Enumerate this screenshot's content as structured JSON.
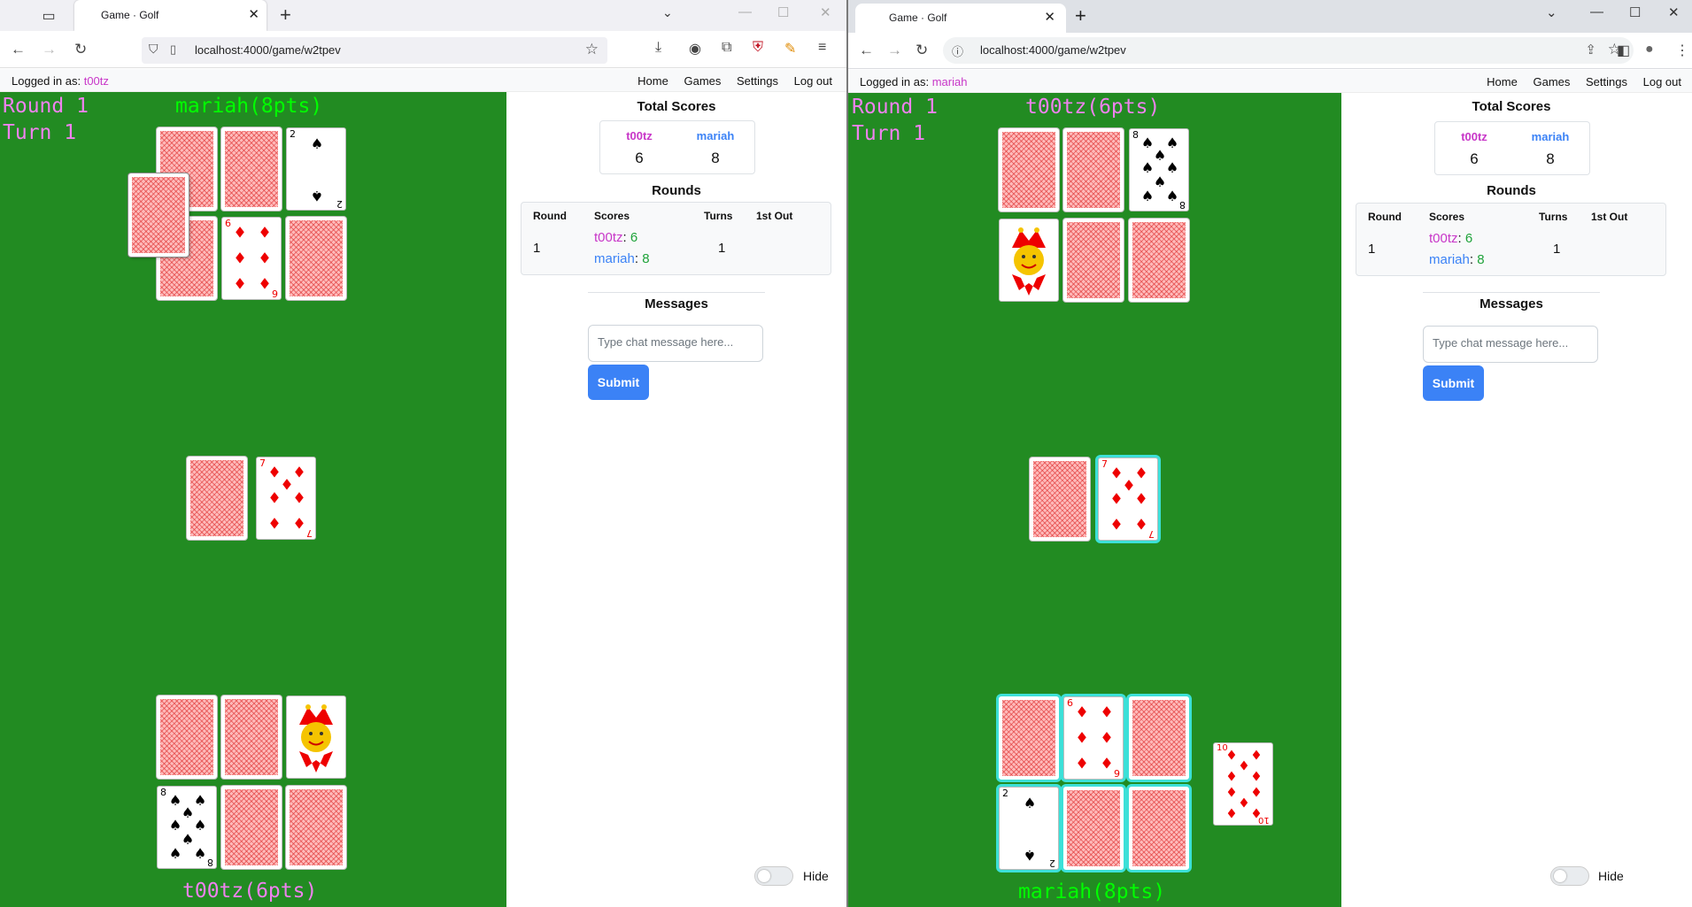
{
  "left_window": {
    "tab_title": "Game · Golf",
    "url": "localhost:4000/game/w2tpev",
    "logged_in_label": "Logged in as:",
    "user": "t00tz",
    "nav": [
      "Home",
      "Games",
      "Settings",
      "Log out"
    ],
    "round_label": "Round 1",
    "turn_label": "Turn 1",
    "opponent": "mariah(8pts)",
    "me": "t00tz(6pts)"
  },
  "right_window": {
    "tab_title": "Game · Golf",
    "url": "localhost:4000/game/w2tpev",
    "logged_in_label": "Logged in as:",
    "user": "mariah",
    "nav": [
      "Home",
      "Games",
      "Settings",
      "Log out"
    ],
    "round_label": "Round 1",
    "turn_label": "Turn 1",
    "opponent": "t00tz(6pts)",
    "me": "mariah(8pts)"
  },
  "cards": {
    "two": "2",
    "six": "6",
    "seven": "7",
    "eight": "8",
    "ten": "10",
    "spade": "♠",
    "diamond": "♦"
  },
  "panel": {
    "total_scores_title": "Total Scores",
    "players": [
      {
        "name": "t00tz",
        "score": "6",
        "color": "#c837c8"
      },
      {
        "name": "mariah",
        "score": "8",
        "color": "#3b82f6"
      }
    ],
    "rounds_title": "Rounds",
    "rounds_headers": [
      "Round",
      "Scores",
      "Turns",
      "1st Out"
    ],
    "rounds_rows": [
      {
        "round": "1",
        "p1_name": "t00tz",
        "p1_score": "6",
        "p2_name": "mariah",
        "p2_score": "8",
        "turns": "1",
        "first_out": ""
      }
    ],
    "messages_title": "Messages",
    "chat_placeholder": "Type chat message here...",
    "submit_label": "Submit",
    "hide_label": "Hide"
  },
  "colors": {
    "table_green": "#228b22",
    "round_turn_text": "#ee82ee",
    "active_name": "#00ff00",
    "inactive_name": "#ee82ee",
    "highlight": "#3ce0d8",
    "submit_blue": "#3b82f6"
  }
}
